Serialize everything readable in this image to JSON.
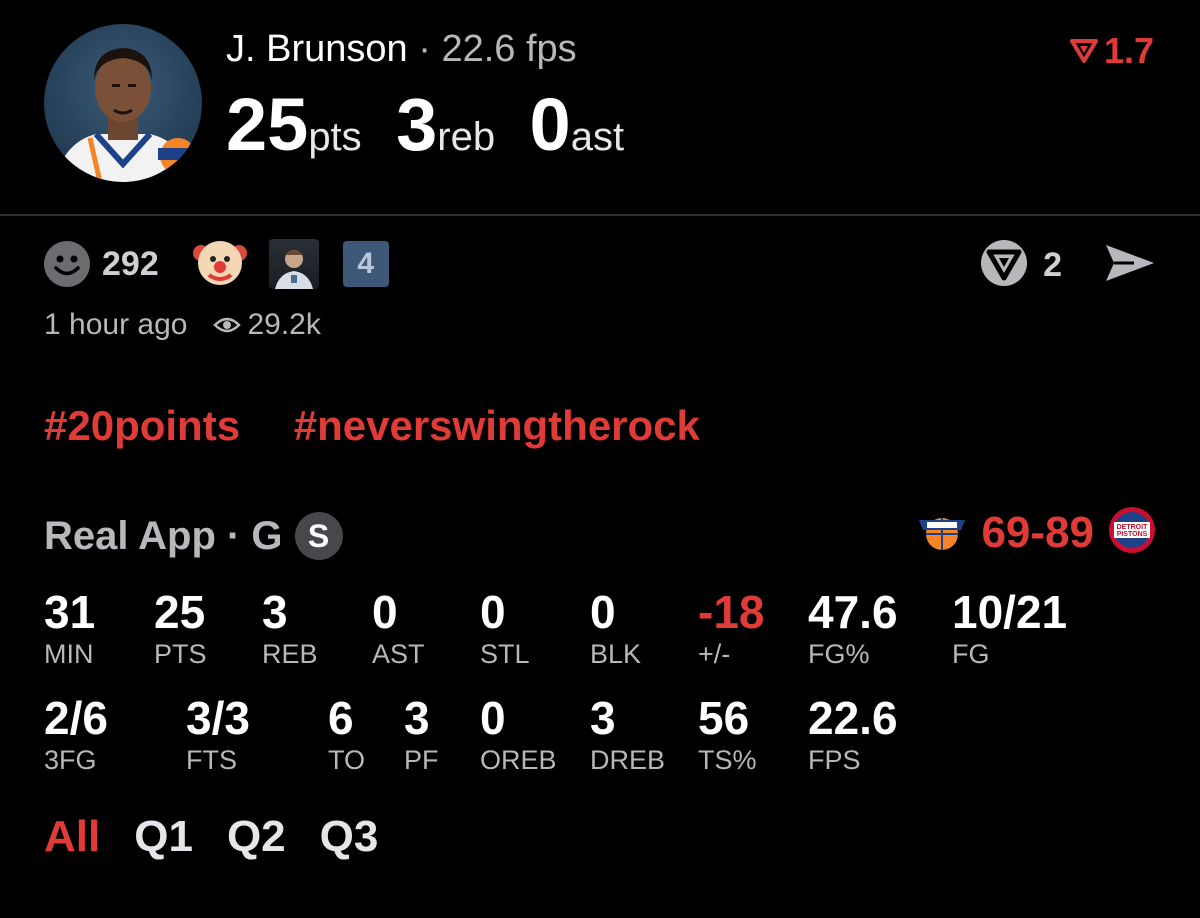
{
  "player": {
    "name": "J. Brunson",
    "separator": "·",
    "fps_text": "22.6 fps",
    "pts": "25",
    "pts_unit": "pts",
    "reb": "3",
    "reb_unit": "reb",
    "ast": "0",
    "ast_unit": "ast",
    "trend_value": "1.7",
    "trend_icon": "down-triangle-icon"
  },
  "social": {
    "reaction_count": "292",
    "extra_count": "4",
    "reply_count": "2",
    "time_ago": "1 hour ago",
    "views": "29.2k"
  },
  "hashtags": [
    "#20points",
    "#neverswingtherock"
  ],
  "game": {
    "source": "Real App · G",
    "s_badge": "S",
    "score": "69-89",
    "home_team_logo": "knicks-logo-icon",
    "away_team_logo": "pistons-logo-icon",
    "pistons_text_1": "DETROIT",
    "pistons_text_2": "PISTONS"
  },
  "stats": {
    "row1": [
      {
        "value": "31",
        "label": "MIN"
      },
      {
        "value": "25",
        "label": "PTS"
      },
      {
        "value": "3",
        "label": "REB"
      },
      {
        "value": "0",
        "label": "AST"
      },
      {
        "value": "0",
        "label": "STL"
      },
      {
        "value": "0",
        "label": "BLK"
      },
      {
        "value": "-18",
        "label": "+/-"
      },
      {
        "value": "47.6",
        "label": "FG%"
      },
      {
        "value": "10/21",
        "label": "FG"
      }
    ],
    "row2": [
      {
        "value": "2/6",
        "label": "3FG"
      },
      {
        "value": "3/3",
        "label": "FTS"
      },
      {
        "value": "6",
        "label": "TO"
      },
      {
        "value": "3",
        "label": "PF"
      },
      {
        "value": "0",
        "label": "OREB"
      },
      {
        "value": "3",
        "label": "DREB"
      },
      {
        "value": "56",
        "label": "TS%"
      },
      {
        "value": "22.6",
        "label": "FPS"
      }
    ]
  },
  "tabs": [
    "All",
    "Q1",
    "Q2",
    "Q3"
  ],
  "active_tab": "All",
  "colors": {
    "accent_red": "#e03b36",
    "muted_text": "#b7b7bc",
    "background": "#000000"
  }
}
